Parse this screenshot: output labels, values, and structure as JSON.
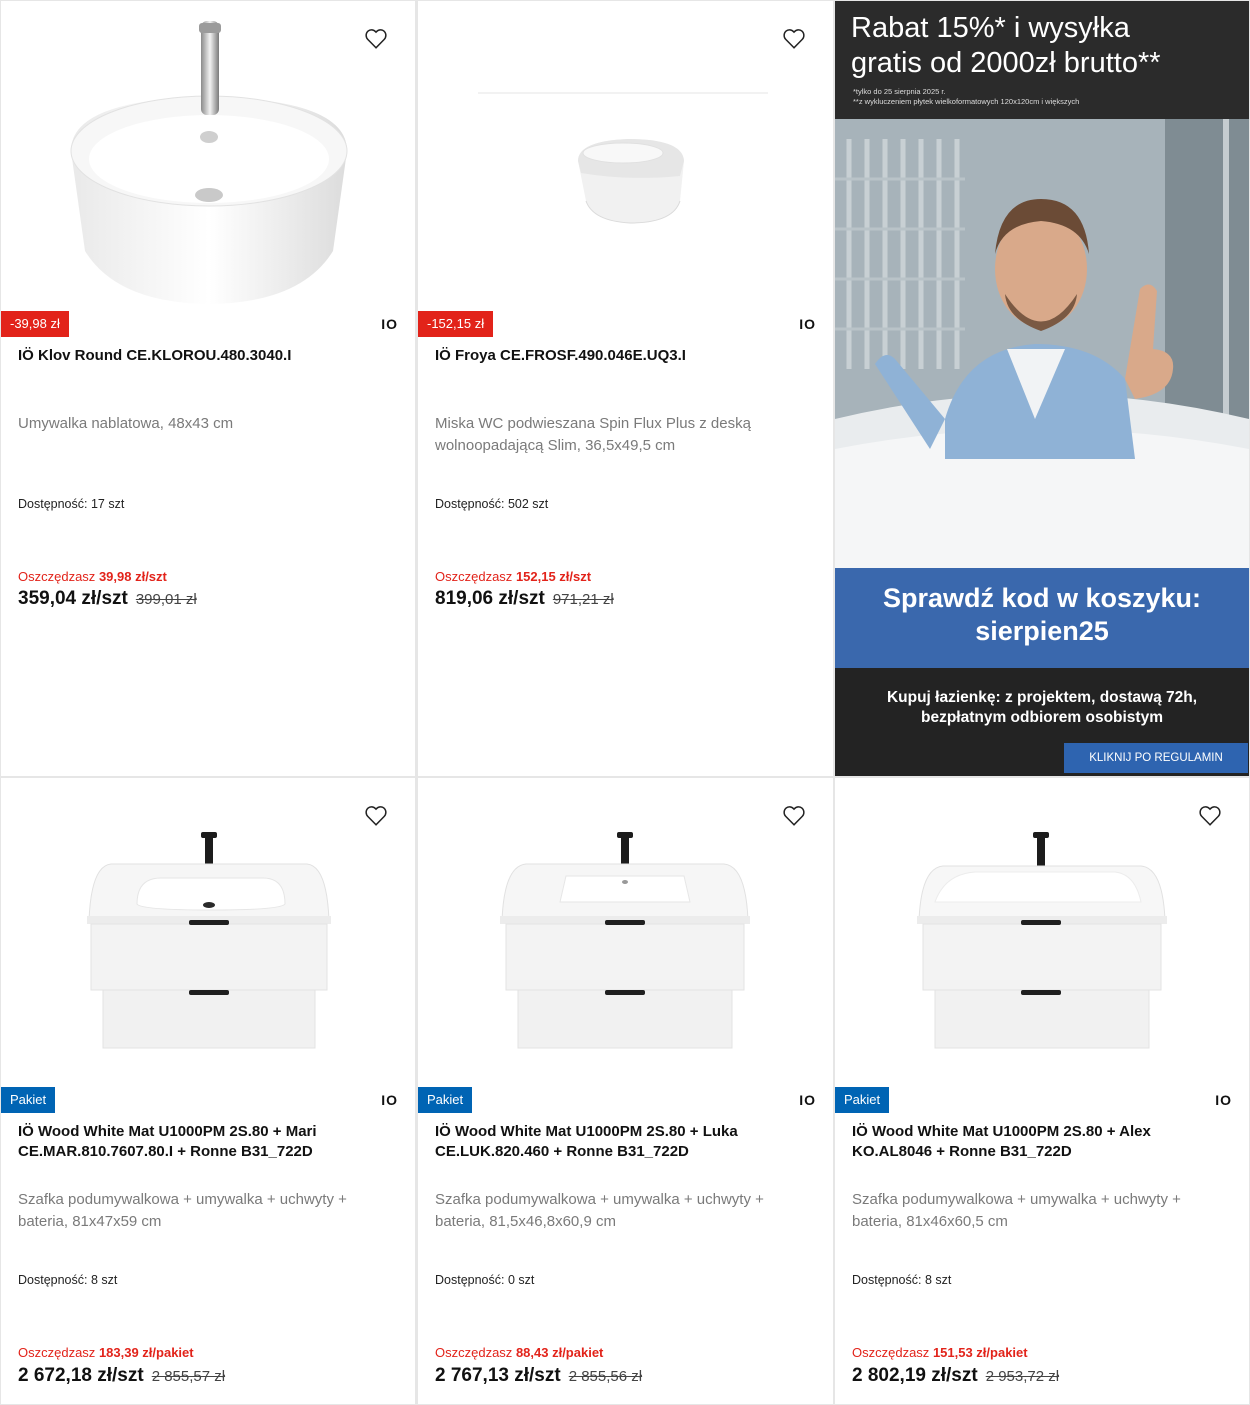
{
  "colors": {
    "sale_red": "#e2231a",
    "package_blue": "#0064b4",
    "promo_blue": "#3a68ad"
  },
  "icons": {
    "wishlist": "heart-icon"
  },
  "products": [
    {
      "badge": "-39,98 zł",
      "brand": "IO",
      "title": "IÖ Klov Round CE.KLOROU.480.3040.I",
      "description": "Umywalka nablatowa, 48x43 cm",
      "availability_label": "Dostępność:",
      "availability_value": "17 szt",
      "save_label": "Oszczędzasz",
      "save_value": "39,98 zł/szt",
      "price": "359,04 zł/szt",
      "old_price": "399,01 zł"
    },
    {
      "badge": "-152,15 zł",
      "brand": "IO",
      "title": "IÖ Froya CE.FROSF.490.046E.UQ3.I",
      "description": "Miska WC podwieszana Spin Flux Plus z deską wolnoopadającą Slim, 36,5x49,5 cm",
      "availability_label": "Dostępność:",
      "availability_value": "502 szt",
      "save_label": "Oszczędzasz",
      "save_value": "152,15 zł/szt",
      "price": "819,06 zł/szt",
      "old_price": "971,21 zł"
    },
    {
      "badge": "Pakiet",
      "brand": "IO",
      "title": "IÖ Wood White Mat U1000PM 2S.80 + Mari CE.MAR.810.7607.80.I + Ronne B31_722D",
      "description": "Szafka podumywalkowa + umywalka + uchwyty + bateria, 81x47x59 cm",
      "availability_label": "Dostępność:",
      "availability_value": "8 szt",
      "save_label": "Oszczędzasz",
      "save_value": "183,39 zł/pakiet",
      "price": "2 672,18 zł/szt",
      "old_price": "2 855,57 zł"
    },
    {
      "badge": "Pakiet",
      "brand": "IO",
      "title": "IÖ Wood White Mat U1000PM 2S.80 + Luka CE.LUK.820.460 + Ronne B31_722D",
      "description": "Szafka podumywalkowa + umywalka + uchwyty + bateria, 81,5x46,8x60,9 cm",
      "availability_label": "Dostępność:",
      "availability_value": "0 szt",
      "save_label": "Oszczędzasz",
      "save_value": "88,43 zł/pakiet",
      "price": "2 767,13 zł/szt",
      "old_price": "2 855,56 zł"
    },
    {
      "badge": "Pakiet",
      "brand": "IO",
      "title": "IÖ Wood White Mat U1000PM 2S.80 + Alex KO.AL8046 + Ronne B31_722D",
      "description": "Szafka podumywalkowa + umywalka + uchwyty + bateria, 81x46x60,5 cm",
      "availability_label": "Dostępność:",
      "availability_value": "8 szt",
      "save_label": "Oszczędzasz",
      "save_value": "151,53 zł/pakiet",
      "price": "2 802,19 zł/szt",
      "old_price": "2 953,72 zł"
    }
  ],
  "promo": {
    "headline_line1": "Rabat 15%* i wysyłka",
    "headline_line2": "gratis od 2000zł brutto**",
    "note_line1": "*tylko do 25 sierpnia 2025 r.",
    "note_line2": "**z wykluczeniem płytek wielkoformatowych 120x120cm i większych",
    "code_line1": "Sprawdź kod w koszyku:",
    "code_line2": "sierpien25",
    "info_line1": "Kupuj łazienkę: z projektem, dostawą 72h,",
    "info_line2": "bezpłatnym odbiorem osobistym",
    "button": "KLIKNIJ PO REGULAMIN"
  }
}
